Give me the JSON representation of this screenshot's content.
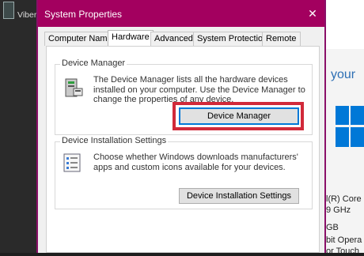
{
  "desktop": {
    "icon_label": "Viber"
  },
  "dialog": {
    "title": "System Properties",
    "tabs": [
      {
        "label": "Computer Name",
        "active": false
      },
      {
        "label": "Hardware",
        "active": true
      },
      {
        "label": "Advanced",
        "active": false
      },
      {
        "label": "System Protection",
        "active": false
      },
      {
        "label": "Remote",
        "active": false
      }
    ],
    "device_manager": {
      "group_title": "Device Manager",
      "description": "The Device Manager lists all the hardware devices installed on your computer. Use the Device Manager to change the properties of any device.",
      "button_label": "Device Manager"
    },
    "device_installation": {
      "group_title": "Device Installation Settings",
      "description": "Choose whether Windows downloads manufacturers' apps and custom icons available for your devices.",
      "button_label": "Device Installation Settings"
    }
  },
  "background_window": {
    "heading_fragment": "your",
    "spec_fragments": [
      "l(R) Core",
      "9 GHz",
      "GB",
      "bit Opera",
      "or Touch"
    ]
  },
  "colors": {
    "title_bar": "#a3005f",
    "highlight": "#d12a3a",
    "windows_blue": "#0078d7"
  }
}
